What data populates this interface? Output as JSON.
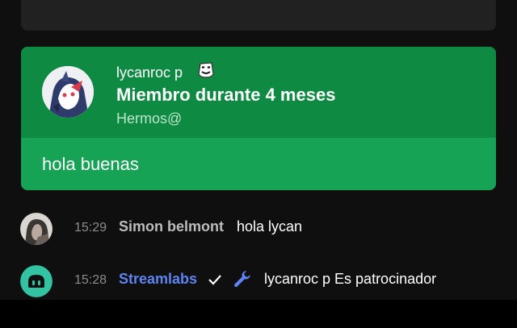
{
  "membership": {
    "author": "lycanroc p",
    "badge_icon": "marshmallow-mask-icon",
    "headline": "Miembro durante 4 meses",
    "subline": "Hermos@",
    "message": "hola buenas",
    "colors": {
      "header": "#0f8a43",
      "body": "#16a356"
    }
  },
  "messages": [
    {
      "time": "15:29",
      "author": "Simon belmont",
      "author_color": "#bdbdbd",
      "text": "hola lycan"
    },
    {
      "time": "15:28",
      "author": "Streamlabs",
      "author_color": "#5e84f1",
      "verified_icon": "checkmark-icon",
      "moderator_icon": "wrench-icon",
      "text": "lycanroc p Es patrocinador"
    }
  ]
}
